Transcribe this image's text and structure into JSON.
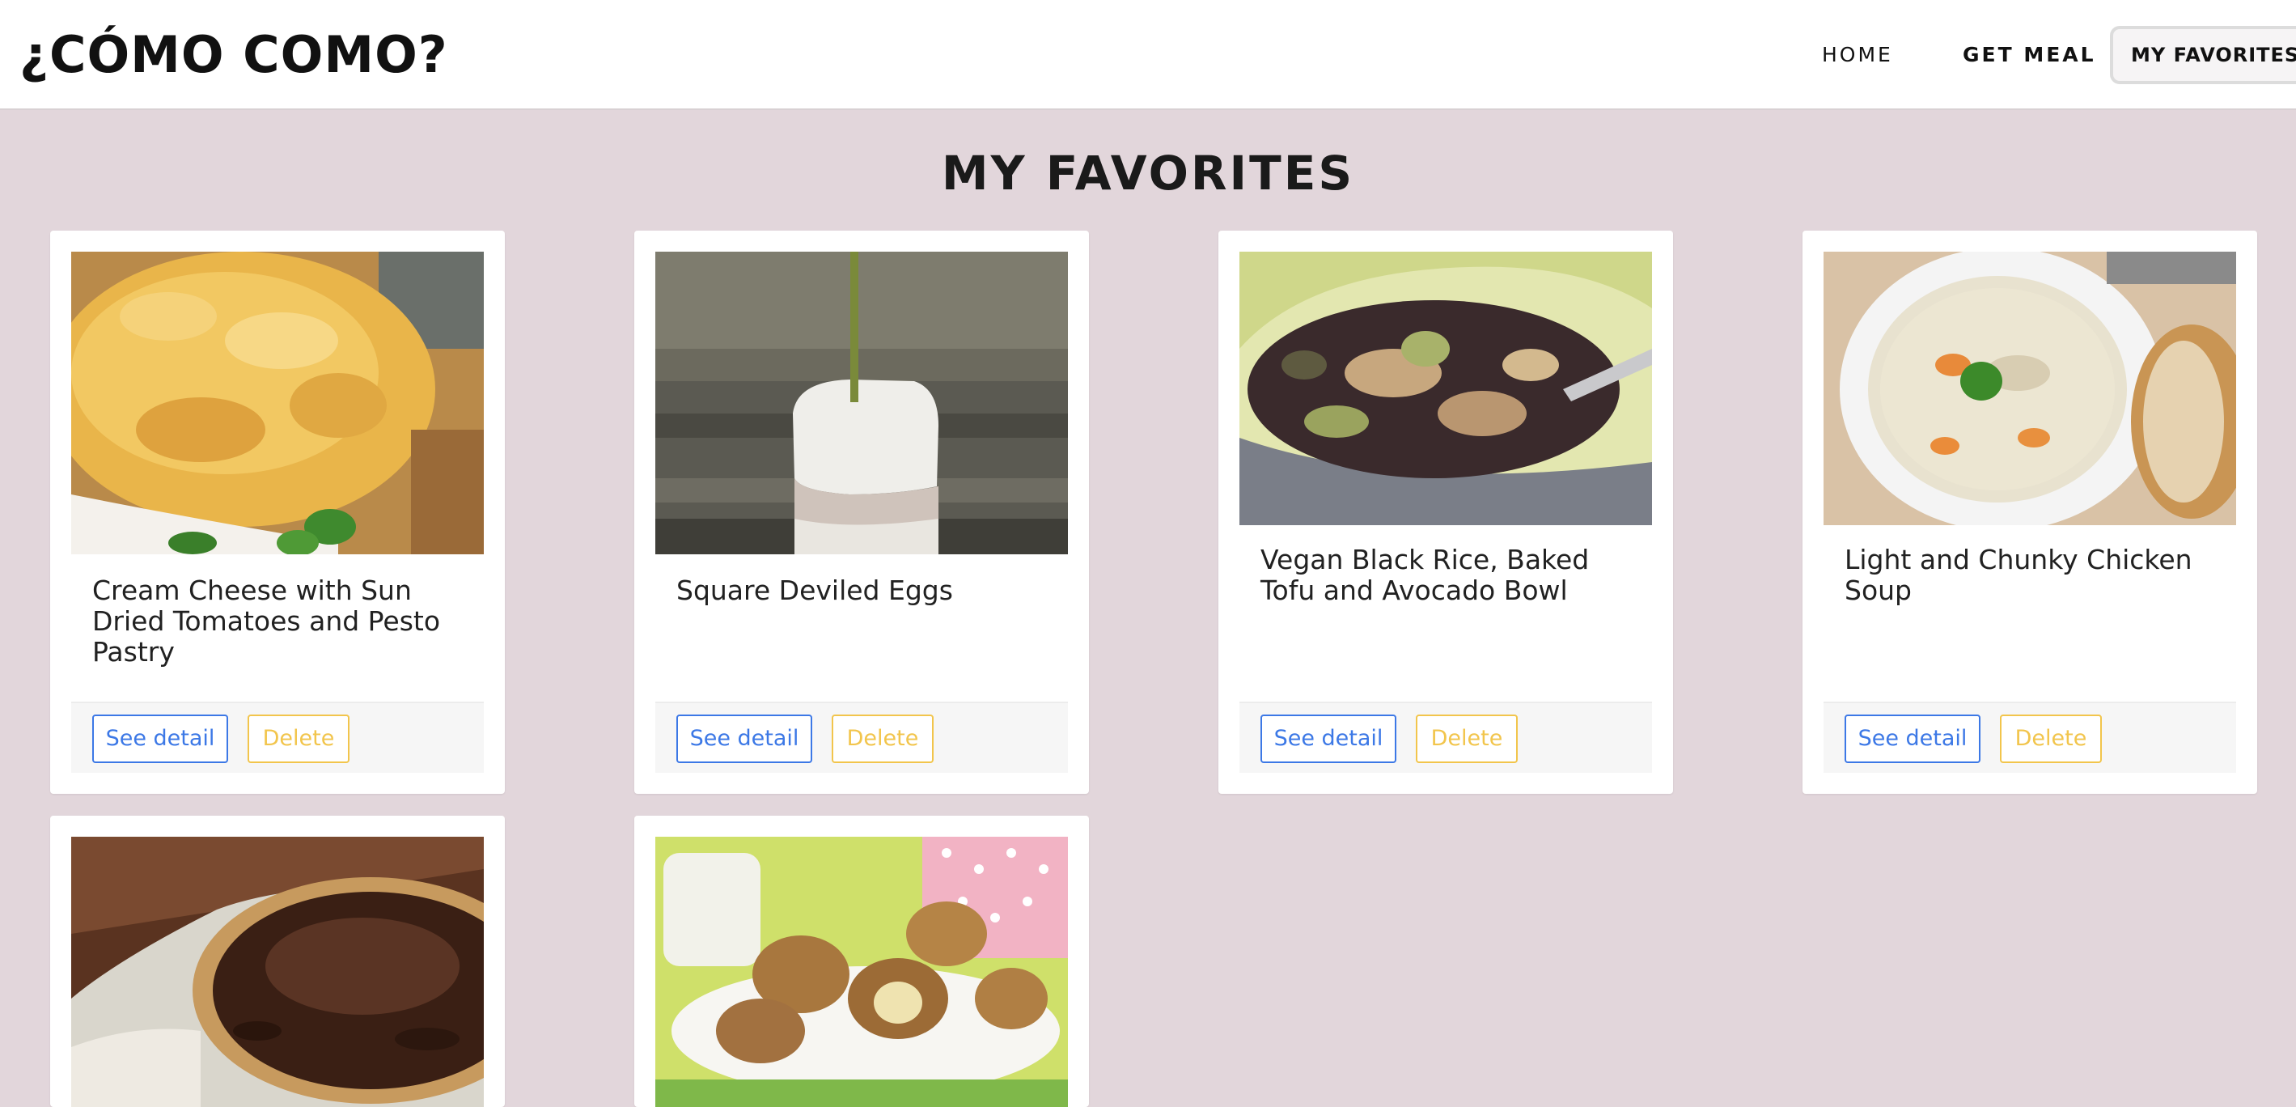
{
  "navbar": {
    "brand": "¿CÓMO COMO?",
    "links": {
      "home": "HOME",
      "get_meal": "GET MEAL",
      "my_favorites": "MY FAVORITES"
    },
    "favorites_icon": "yellow-heart-icon",
    "favorites_icon_color": "#f5c518"
  },
  "page": {
    "title": "MY FAVORITES"
  },
  "favorites": [
    {
      "title": "Cream Cheese with Sun Dried Tomatoes and Pesto Pastry",
      "image": "pastry-photo",
      "see_detail": "See detail",
      "delete": "Delete"
    },
    {
      "title": "Square Deviled Eggs",
      "image": "deviled-eggs-photo",
      "see_detail": "See detail",
      "delete": "Delete"
    },
    {
      "title": "Vegan Black Rice, Baked Tofu and Avocado Bowl",
      "image": "rice-bowl-photo",
      "see_detail": "See detail",
      "delete": "Delete"
    },
    {
      "title": "Light and Chunky Chicken Soup",
      "image": "chicken-soup-photo",
      "see_detail": "See detail",
      "delete": "Delete"
    },
    {
      "title": "",
      "image": "chocolate-pie-photo"
    },
    {
      "title": "",
      "image": "banana-truffles-photo"
    }
  ],
  "colors": {
    "background": "#e2d6db",
    "primary": "#3c78e6",
    "warning": "#f2c54c"
  }
}
